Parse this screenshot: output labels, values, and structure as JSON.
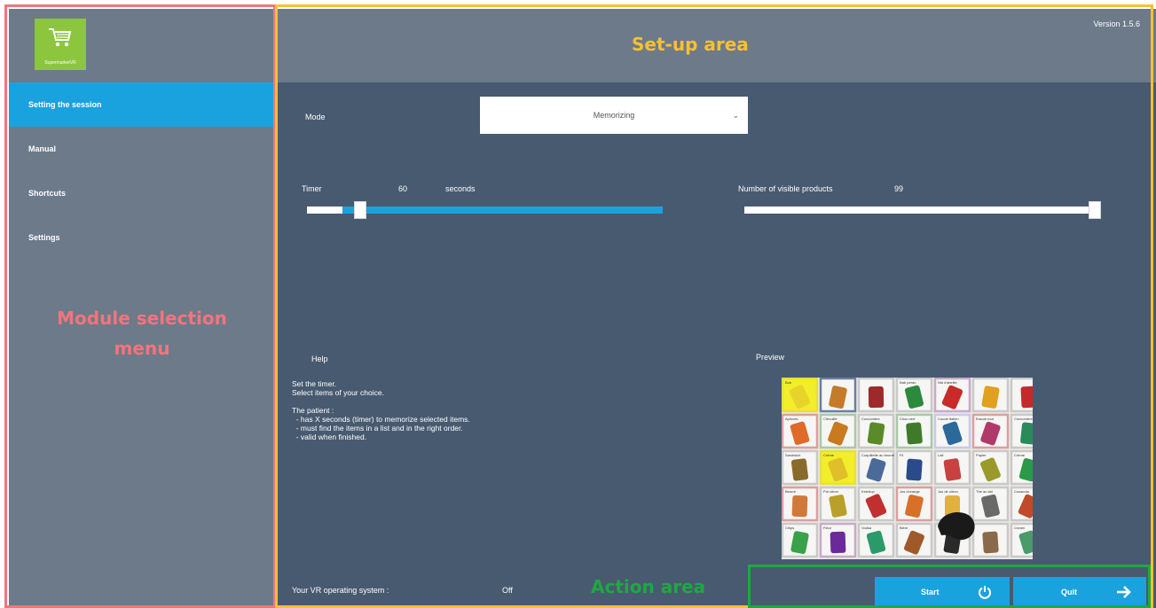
{
  "app": {
    "logo_text": "SupermarketVR",
    "version": "Version 1.5.6"
  },
  "sidebar": {
    "items": [
      {
        "label": "Setting the session",
        "active": true
      },
      {
        "label": "Manual",
        "active": false
      },
      {
        "label": "Shortcuts",
        "active": false
      },
      {
        "label": "Settings",
        "active": false
      }
    ]
  },
  "setup": {
    "mode_label": "Mode",
    "mode_value": "Memorizing",
    "timer_label": "Timer",
    "timer_value": "60",
    "timer_unit": "seconds",
    "timer_level": 0.1,
    "products_label": "Number of visible products",
    "products_value": "99",
    "products_level": 1.0
  },
  "help": {
    "title": "Help",
    "lines": [
      "Set the timer.",
      "Select items of your choice.",
      "",
      "The patient :",
      "  - has X seconds (timer) to memorize selected items.",
      "  - must find the items in a list and in the right order.",
      "  - valid when finished."
    ]
  },
  "preview": {
    "title": "Preview",
    "tile_labels": [
      "Bub",
      "",
      "",
      "Bab perdu",
      "Nid d'abeille",
      "",
      "",
      "Apricots",
      "Citrouille",
      "Concombre",
      "Chou vert",
      "Coude Italien",
      "Essuie-tout",
      "Concombre",
      "Sandwich",
      "Crème",
      "Coquillette au beurre",
      "Fil",
      "Lait",
      "Papier",
      "Crème",
      "Beurre",
      "Pot citron",
      "Ketchup",
      "Jus d'orange",
      "Jus de citron",
      "Thé au lait",
      "Cocacola",
      "Chips",
      "Fleur",
      "Vodka",
      "Bière",
      "",
      "",
      "Cream"
    ],
    "tile_colors": [
      "#e7d42a",
      "#c47b2a",
      "#9c2a2a",
      "#2b8a3e",
      "#c92a2a",
      "#e0a020",
      "#c42a2a",
      "#e06a2a",
      "#c97a1e",
      "#5a8a2a",
      "#3f7a2a",
      "#2a6a9a",
      "#b03a6a",
      "#2a8a5a",
      "#8a6a2a",
      "#e0c02a",
      "#4a6a9a",
      "#2a4a8a",
      "#c84040",
      "#9a9a2a",
      "#2a9a4a",
      "#d07a3a",
      "#b8a02a",
      "#c03030",
      "#d9702a",
      "#e0b040",
      "#6a6a6a",
      "#c04a2a",
      "#3aa04a",
      "#6a2a9a",
      "#2a9a6a",
      "#a05a2a",
      "#2a2a2a",
      "#8a6a4a",
      "#4a9a6a"
    ],
    "tile_borders": [
      "#e6e03a",
      "#6a7ea8",
      "#c9c9c9",
      "#c9c9c9",
      "#c9a9c9",
      "#c9c9c9",
      "#c9c9c9",
      "#d9a0a0",
      "#a9c9a9",
      "#c9c9c9",
      "#a9c9a9",
      "#c9c9e9",
      "#d9a0a0",
      "#c9c9c9",
      "#c9c9c9",
      "#e6e03a",
      "#c9c9c9",
      "#c9c9c9",
      "#c9c9c9",
      "#c9c9c9",
      "#c9c9c9",
      "#d9a0a0",
      "#c9c9c9",
      "#c9c9c9",
      "#d9a0a0",
      "#c9c9c9",
      "#c9c9c9",
      "#c9c9c9",
      "#c9c9c9",
      "#c9a9c9",
      "#c9c9c9",
      "#c9c9c9",
      "#c9c9c9",
      "#c9c9c9",
      "#c9c9c9"
    ]
  },
  "footer": {
    "vr_label": "Your VR operating system :",
    "vr_value": "Off",
    "start_label": "Start",
    "quit_label": "Quit"
  },
  "annotations": {
    "menu_title": "Module selection\nmenu",
    "setup_title": "Set-up area",
    "action_title": "Action area",
    "colors": {
      "menu": "#f4747c",
      "setup": "#f8c033",
      "action": "#1fa842"
    }
  },
  "colors": {
    "accent": "#1aa2df",
    "sidebar_bg": "#6d7a89",
    "main_bg": "#485a70",
    "logo_green": "#8cc63f"
  }
}
